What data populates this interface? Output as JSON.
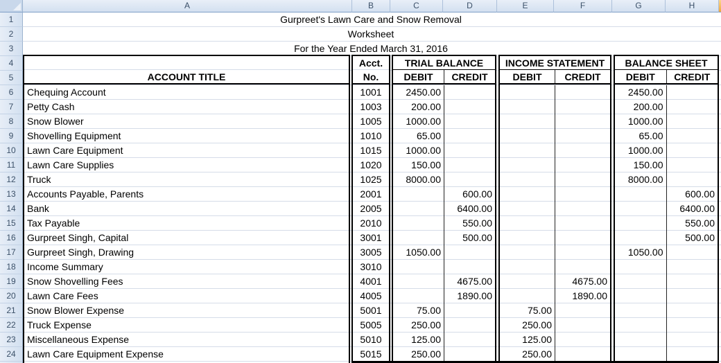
{
  "titles": {
    "company": "Gurpreet's Lawn Care and Snow Removal",
    "report": "Worksheet",
    "period": "For the Year Ended March 31, 2016"
  },
  "sheet": {
    "column_headers": [
      "A",
      "B",
      "C",
      "D",
      "E",
      "F",
      "G",
      "H"
    ],
    "row_headers": [
      "1",
      "2",
      "3",
      "4",
      "5",
      "6",
      "7",
      "8",
      "9",
      "10",
      "11",
      "12",
      "13",
      "14",
      "15",
      "16",
      "17",
      "18",
      "19",
      "20",
      "21",
      "22",
      "23",
      "24"
    ]
  },
  "colors": {
    "section_border": "#000000",
    "gridline": "#D5DCE8",
    "header_background_top": "#E9EFF8",
    "header_background_bottom": "#D3E0F0",
    "selected_column_header": "#F0A73E"
  },
  "table": {
    "account_title_header": "ACCOUNT TITLE",
    "acct_header": "Acct.",
    "no_header": "No.",
    "debit_label": "DEBIT",
    "credit_label": "CREDIT",
    "sections": [
      {
        "label": "TRIAL BALANCE"
      },
      {
        "label": "INCOME STATEMENT"
      },
      {
        "label": "BALANCE SHEET"
      }
    ],
    "accounts": [
      {
        "title": "Chequing Account",
        "no": "1001",
        "tb_debit": "2450.00",
        "tb_credit": "",
        "is_debit": "",
        "is_credit": "",
        "bs_debit": "2450.00",
        "bs_credit": ""
      },
      {
        "title": "Petty Cash",
        "no": "1003",
        "tb_debit": "200.00",
        "tb_credit": "",
        "is_debit": "",
        "is_credit": "",
        "bs_debit": "200.00",
        "bs_credit": ""
      },
      {
        "title": "Snow Blower",
        "no": "1005",
        "tb_debit": "1000.00",
        "tb_credit": "",
        "is_debit": "",
        "is_credit": "",
        "bs_debit": "1000.00",
        "bs_credit": ""
      },
      {
        "title": "Shovelling Equipment",
        "no": "1010",
        "tb_debit": "65.00",
        "tb_credit": "",
        "is_debit": "",
        "is_credit": "",
        "bs_debit": "65.00",
        "bs_credit": ""
      },
      {
        "title": "Lawn Care Equipment",
        "no": "1015",
        "tb_debit": "1000.00",
        "tb_credit": "",
        "is_debit": "",
        "is_credit": "",
        "bs_debit": "1000.00",
        "bs_credit": ""
      },
      {
        "title": "Lawn Care Supplies",
        "no": "1020",
        "tb_debit": "150.00",
        "tb_credit": "",
        "is_debit": "",
        "is_credit": "",
        "bs_debit": "150.00",
        "bs_credit": ""
      },
      {
        "title": "Truck",
        "no": "1025",
        "tb_debit": "8000.00",
        "tb_credit": "",
        "is_debit": "",
        "is_credit": "",
        "bs_debit": "8000.00",
        "bs_credit": ""
      },
      {
        "title": "Accounts Payable, Parents",
        "no": "2001",
        "tb_debit": "",
        "tb_credit": "600.00",
        "is_debit": "",
        "is_credit": "",
        "bs_debit": "",
        "bs_credit": "600.00"
      },
      {
        "title": "Bank",
        "no": "2005",
        "tb_debit": "",
        "tb_credit": "6400.00",
        "is_debit": "",
        "is_credit": "",
        "bs_debit": "",
        "bs_credit": "6400.00"
      },
      {
        "title": "Tax Payable",
        "no": "2010",
        "tb_debit": "",
        "tb_credit": "550.00",
        "is_debit": "",
        "is_credit": "",
        "bs_debit": "",
        "bs_credit": "550.00"
      },
      {
        "title": "Gurpreet Singh, Capital",
        "no": "3001",
        "tb_debit": "",
        "tb_credit": "500.00",
        "is_debit": "",
        "is_credit": "",
        "bs_debit": "",
        "bs_credit": "500.00"
      },
      {
        "title": "Gurpreet Singh, Drawing",
        "no": "3005",
        "tb_debit": "1050.00",
        "tb_credit": "",
        "is_debit": "",
        "is_credit": "",
        "bs_debit": "1050.00",
        "bs_credit": ""
      },
      {
        "title": "Income Summary",
        "no": "3010",
        "tb_debit": "",
        "tb_credit": "",
        "is_debit": "",
        "is_credit": "",
        "bs_debit": "",
        "bs_credit": ""
      },
      {
        "title": "Snow Shovelling Fees",
        "no": "4001",
        "tb_debit": "",
        "tb_credit": "4675.00",
        "is_debit": "",
        "is_credit": "4675.00",
        "bs_debit": "",
        "bs_credit": ""
      },
      {
        "title": "Lawn Care Fees",
        "no": "4005",
        "tb_debit": "",
        "tb_credit": "1890.00",
        "is_debit": "",
        "is_credit": "1890.00",
        "bs_debit": "",
        "bs_credit": ""
      },
      {
        "title": "Snow Blower Expense",
        "no": "5001",
        "tb_debit": "75.00",
        "tb_credit": "",
        "is_debit": "75.00",
        "is_credit": "",
        "bs_debit": "",
        "bs_credit": ""
      },
      {
        "title": "Truck Expense",
        "no": "5005",
        "tb_debit": "250.00",
        "tb_credit": "",
        "is_debit": "250.00",
        "is_credit": "",
        "bs_debit": "",
        "bs_credit": ""
      },
      {
        "title": "Miscellaneous Expense",
        "no": "5010",
        "tb_debit": "125.00",
        "tb_credit": "",
        "is_debit": "125.00",
        "is_credit": "",
        "bs_debit": "",
        "bs_credit": ""
      },
      {
        "title": "Lawn Care Equipment Expense",
        "no": "5015",
        "tb_debit": "250.00",
        "tb_credit": "",
        "is_debit": "250.00",
        "is_credit": "",
        "bs_debit": "",
        "bs_credit": ""
      }
    ]
  }
}
